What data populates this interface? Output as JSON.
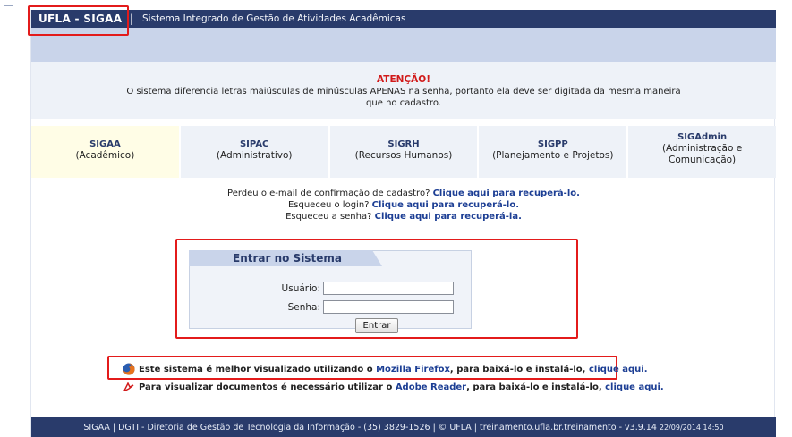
{
  "header": {
    "brand": "UFLA - SIGAA",
    "separator": "|",
    "system_name": "Sistema Integrado de Gestão de Atividades Acadêmicas"
  },
  "notice": {
    "title": "ATENÇÃO!",
    "text": "O sistema diferencia letras maiúsculas de minúsculas APENAS na senha, portanto ela deve ser digitada da mesma maneira que no cadastro."
  },
  "systems": [
    {
      "name": "SIGAA",
      "desc": "(Acadêmico)"
    },
    {
      "name": "SIPAC",
      "desc": "(Administrativo)"
    },
    {
      "name": "SIGRH",
      "desc": "(Recursos Humanos)"
    },
    {
      "name": "SIGPP",
      "desc": "(Planejamento e Projetos)"
    },
    {
      "name": "SIGAdmin",
      "desc": "(Administração e Comunicação)"
    }
  ],
  "recover": {
    "email_text": "Perdeu o e-mail de confirmação de cadastro?",
    "email_link": "Clique aqui para recuperá-lo.",
    "login_text": "Esqueceu o login?",
    "login_link": "Clique aqui para recuperá-lo.",
    "password_text": "Esqueceu a senha?",
    "password_link": "Clique aqui para recuperá-la."
  },
  "login": {
    "title": "Entrar no Sistema",
    "user_label": "Usuário:",
    "user_value": "",
    "password_label": "Senha:",
    "password_value": "",
    "submit_label": "Entrar"
  },
  "notes": {
    "firefox_text": "Este sistema é melhor visualizado utilizando o",
    "firefox_link": "Mozilla Firefox",
    "firefox_mid": ", para baixá-lo e instalá-lo,",
    "firefox_click": "clique aqui.",
    "pdf_text": "Para visualizar documentos é necessário utilizar o",
    "pdf_link": "Adobe Reader",
    "pdf_mid": ", para baixá-lo e instalá-lo,",
    "pdf_click": "clique aqui."
  },
  "footer": {
    "text": "SIGAA | DGTI - Diretoria de Gestão de Tecnologia da Informação - (35) 3829-1526 | © UFLA | treinamento.ufla.br.treinamento - v3.9.14",
    "timestamp": "22/09/2014 14:50"
  },
  "colors": {
    "header_bg": "#293b6b",
    "band_bg": "#c9d4ea",
    "alert_red": "#d11a1a",
    "link_blue": "#1c3e94",
    "highlight_frame": "#e31b1b"
  }
}
